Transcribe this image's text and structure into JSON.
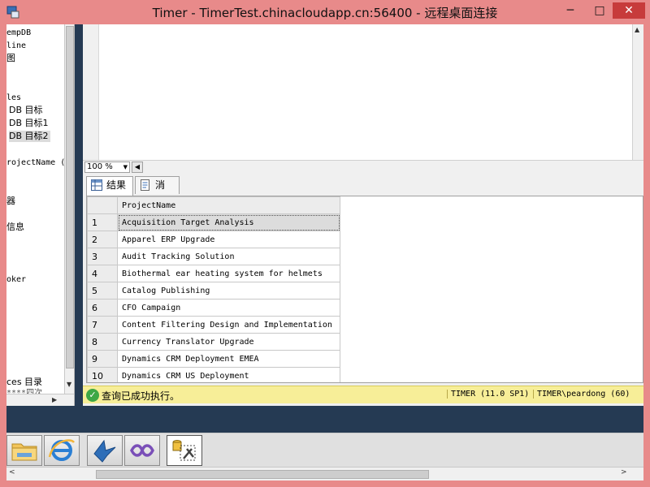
{
  "window": {
    "title": "Timer - TimerTest.chinacloudapp.cn:56400 - 远程桌面连接",
    "min": "─",
    "max": "□",
    "close": "✕"
  },
  "explorer": {
    "lines": [
      {
        "text": "empDB"
      },
      {
        "text": "line"
      },
      {
        "text": "图"
      },
      {
        "text": "les"
      },
      {
        "text": "DB 目标"
      },
      {
        "text": "DB 目标1"
      },
      {
        "text": "DB 目标2",
        "selected": true
      },
      {
        "text": "rojectName ("
      },
      {
        "text": "器"
      },
      {
        "text": "信息"
      },
      {
        "text": "oker"
      },
      {
        "text": "ces 目录"
      },
      {
        "text": "****四次"
      }
    ]
  },
  "editor": {
    "zoom": "100 %"
  },
  "results": {
    "tabs": [
      {
        "label": "结果",
        "active": true
      },
      {
        "label": "消息",
        "active": false
      }
    ],
    "column": "ProjectName",
    "rows": [
      {
        "num": "1",
        "value": "Acquisition Target Analysis"
      },
      {
        "num": "2",
        "value": "Apparel ERP Upgrade"
      },
      {
        "num": "3",
        "value": "Audit Tracking Solution"
      },
      {
        "num": "4",
        "value": "Biothermal ear heating system for helmets"
      },
      {
        "num": "5",
        "value": "Catalog Publishing"
      },
      {
        "num": "6",
        "value": "CFO Campaign"
      },
      {
        "num": "7",
        "value": "Content Filtering Design and Implementation"
      },
      {
        "num": "8",
        "value": "Currency Translator Upgrade"
      },
      {
        "num": "9",
        "value": "Dynamics CRM Deployment EMEA"
      },
      {
        "num": "10",
        "value": "Dynamics CRM US Deployment"
      }
    ],
    "status": {
      "message": "查询已成功执行。",
      "server": "TIMER (11.0 SP1)",
      "user": "TIMER\\peardong (60)",
      "color": "#f7ee98"
    }
  },
  "taskbar": {
    "apps": [
      "folder-icon",
      "ie-icon",
      "bird-icon",
      "visual-studio-icon",
      "ssms-icon"
    ]
  }
}
